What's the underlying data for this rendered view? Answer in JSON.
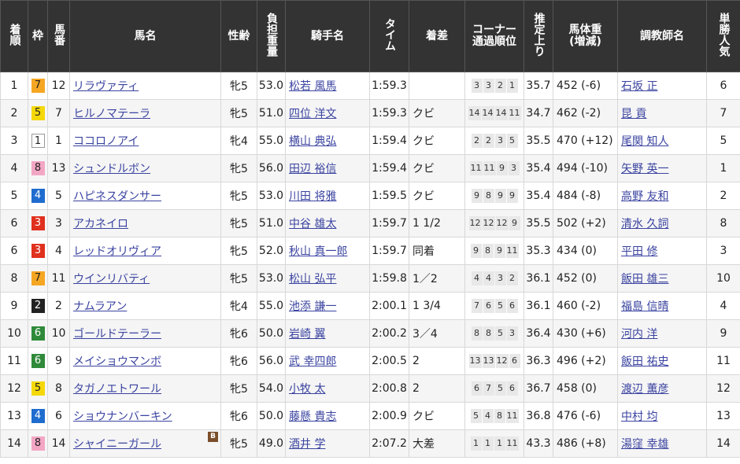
{
  "headers": {
    "rank": "着順",
    "waku": "枠",
    "umaban": "馬番",
    "horse": "馬名",
    "sexage": "性齢",
    "weight": "負担重量",
    "jockey": "騎手名",
    "time": "タイム",
    "margin": "着差",
    "corner_top": "コーナー",
    "corner_bottom": "通過順位",
    "last3f": "推定上り",
    "body_top": "馬体重",
    "body_bottom": "(増減)",
    "trainer": "調教師名",
    "odds_rank": "単勝人気"
  },
  "colors": {
    "header_bg": "#333333",
    "link": "#3a43a0"
  },
  "rows": [
    {
      "rank": "1",
      "waku": "7",
      "umaban": "12",
      "horse": "リラヴァティ",
      "badge": "",
      "sexage": "牝5",
      "weight": "53.0",
      "jockey": "松若 風馬",
      "time": "1:59.3",
      "margin": "",
      "corners": [
        "3",
        "3",
        "2",
        "1"
      ],
      "last3f": "35.7",
      "body": "452 (-6)",
      "trainer": "石坂 正",
      "pop": "6"
    },
    {
      "rank": "2",
      "waku": "5",
      "umaban": "7",
      "horse": "ヒルノマテーラ",
      "badge": "",
      "sexage": "牝5",
      "weight": "51.0",
      "jockey": "四位 洋文",
      "time": "1:59.3",
      "margin": "クビ",
      "corners": [
        "14",
        "14",
        "14",
        "11"
      ],
      "last3f": "34.7",
      "body": "462 (-2)",
      "trainer": "昆 貢",
      "pop": "7"
    },
    {
      "rank": "3",
      "waku": "1",
      "umaban": "1",
      "horse": "ココロノアイ",
      "badge": "",
      "sexage": "牝4",
      "weight": "55.0",
      "jockey": "横山 典弘",
      "time": "1:59.4",
      "margin": "クビ",
      "corners": [
        "2",
        "2",
        "3",
        "5"
      ],
      "last3f": "35.5",
      "body": "470 (+12)",
      "trainer": "尾関 知人",
      "pop": "5"
    },
    {
      "rank": "4",
      "waku": "8",
      "umaban": "13",
      "horse": "シュンドルボン",
      "badge": "",
      "sexage": "牝5",
      "weight": "56.0",
      "jockey": "田辺 裕信",
      "time": "1:59.4",
      "margin": "クビ",
      "corners": [
        "11",
        "11",
        "9",
        "3"
      ],
      "last3f": "35.4",
      "body": "494 (-10)",
      "trainer": "矢野 英一",
      "pop": "1"
    },
    {
      "rank": "5",
      "waku": "4",
      "umaban": "5",
      "horse": "ハピネスダンサー",
      "badge": "",
      "sexage": "牝5",
      "weight": "53.0",
      "jockey": "川田 将雅",
      "time": "1:59.5",
      "margin": "クビ",
      "corners": [
        "9",
        "8",
        "9",
        "9"
      ],
      "last3f": "35.4",
      "body": "484 (-8)",
      "trainer": "高野 友和",
      "pop": "2"
    },
    {
      "rank": "6",
      "waku": "3",
      "umaban": "3",
      "horse": "アカネイロ",
      "badge": "",
      "sexage": "牝5",
      "weight": "51.0",
      "jockey": "中谷 雄太",
      "time": "1:59.7",
      "margin": "1 1/2",
      "corners": [
        "12",
        "12",
        "12",
        "9"
      ],
      "last3f": "35.5",
      "body": "502 (+2)",
      "trainer": "清水 久詞",
      "pop": "8"
    },
    {
      "rank": "6",
      "waku": "3",
      "umaban": "4",
      "horse": "レッドオリヴィア",
      "badge": "",
      "sexage": "牝5",
      "weight": "52.0",
      "jockey": "秋山 真一郎",
      "time": "1:59.7",
      "margin": "同着",
      "corners": [
        "9",
        "8",
        "9",
        "11"
      ],
      "last3f": "35.3",
      "body": "434 (0)",
      "trainer": "平田 修",
      "pop": "3"
    },
    {
      "rank": "8",
      "waku": "7",
      "umaban": "11",
      "horse": "ウインリバティ",
      "badge": "",
      "sexage": "牝5",
      "weight": "53.0",
      "jockey": "松山 弘平",
      "time": "1:59.8",
      "margin": "1／2",
      "corners": [
        "4",
        "4",
        "3",
        "2"
      ],
      "last3f": "36.1",
      "body": "452 (0)",
      "trainer": "飯田 雄三",
      "pop": "10"
    },
    {
      "rank": "9",
      "waku": "2",
      "umaban": "2",
      "horse": "ナムラアン",
      "badge": "",
      "sexage": "牝4",
      "weight": "55.0",
      "jockey": "池添 謙一",
      "time": "2:00.1",
      "margin": "1 3/4",
      "corners": [
        "7",
        "6",
        "5",
        "6"
      ],
      "last3f": "36.1",
      "body": "460 (-2)",
      "trainer": "福島 信晴",
      "pop": "4"
    },
    {
      "rank": "10",
      "waku": "6",
      "umaban": "10",
      "horse": "ゴールドテーラー",
      "badge": "",
      "sexage": "牝6",
      "weight": "50.0",
      "jockey": "岩崎 翼",
      "time": "2:00.2",
      "margin": "3／4",
      "corners": [
        "8",
        "8",
        "5",
        "3"
      ],
      "last3f": "36.4",
      "body": "430 (+6)",
      "trainer": "河内 洋",
      "pop": "9"
    },
    {
      "rank": "11",
      "waku": "6",
      "umaban": "9",
      "horse": "メイショウマンボ",
      "badge": "",
      "sexage": "牝6",
      "weight": "56.0",
      "jockey": "武 幸四郎",
      "time": "2:00.5",
      "margin": "2",
      "corners": [
        "13",
        "13",
        "12",
        "6"
      ],
      "last3f": "36.3",
      "body": "496 (+2)",
      "trainer": "飯田 祐史",
      "pop": "11"
    },
    {
      "rank": "12",
      "waku": "5",
      "umaban": "8",
      "horse": "タガノエトワール",
      "badge": "",
      "sexage": "牝5",
      "weight": "54.0",
      "jockey": "小牧 太",
      "time": "2:00.8",
      "margin": "2",
      "corners": [
        "6",
        "7",
        "5",
        "6"
      ],
      "last3f": "36.7",
      "body": "458 (0)",
      "trainer": "渡辺 薫彦",
      "pop": "12"
    },
    {
      "rank": "13",
      "waku": "4",
      "umaban": "6",
      "horse": "ショウナンバーキン",
      "badge": "",
      "sexage": "牝6",
      "weight": "50.0",
      "jockey": "藤懸 貴志",
      "time": "2:00.9",
      "margin": "クビ",
      "corners": [
        "5",
        "4",
        "8",
        "11"
      ],
      "last3f": "36.8",
      "body": "476 (-6)",
      "trainer": "中村 均",
      "pop": "13"
    },
    {
      "rank": "14",
      "waku": "8",
      "umaban": "14",
      "horse": "シャイニーガール",
      "badge": "B",
      "sexage": "牝5",
      "weight": "49.0",
      "jockey": "酒井 学",
      "time": "2:07.2",
      "margin": "大差",
      "corners": [
        "1",
        "1",
        "1",
        "11"
      ],
      "last3f": "43.3",
      "body": "486 (+8)",
      "trainer": "湯窪 幸雄",
      "pop": "14"
    }
  ]
}
